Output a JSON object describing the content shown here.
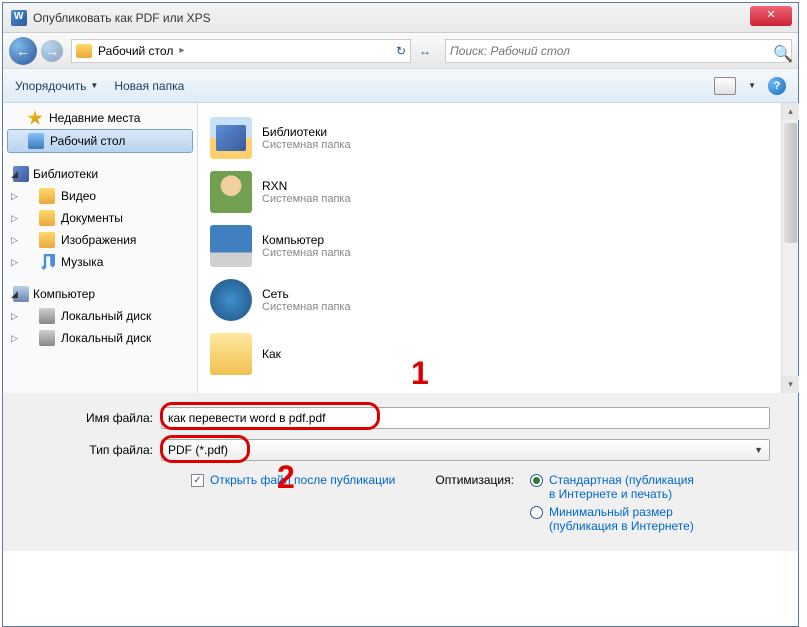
{
  "titlebar": {
    "title": "Опубликовать как PDF или XPS",
    "close": "✕"
  },
  "nav": {
    "location": "Рабочий стол",
    "arrow": "▸",
    "search_placeholder": "Поиск: Рабочий стол"
  },
  "toolbar": {
    "organize": "Упорядочить",
    "new_folder": "Новая папка",
    "help": "?"
  },
  "sidebar": {
    "recent": "Недавние места",
    "desktop": "Рабочий стол",
    "libraries": "Библиотеки",
    "video": "Видео",
    "documents": "Документы",
    "images": "Изображения",
    "music": "Музыка",
    "computer": "Компьютер",
    "disk1": "Локальный диск",
    "disk2": "Локальный диск"
  },
  "files": [
    {
      "name": "Библиотеки",
      "sub": "Системная папка"
    },
    {
      "name": "RXN",
      "sub": "Системная папка"
    },
    {
      "name": "Компьютер",
      "sub": "Системная папка"
    },
    {
      "name": "Сеть",
      "sub": "Системная папка"
    },
    {
      "name": "Как",
      "sub": ""
    }
  ],
  "form": {
    "filename_label": "Имя файла:",
    "filename_value": "как перевести word в pdf.pdf",
    "filetype_label": "Тип файла:",
    "filetype_value": "PDF (*.pdf)",
    "open_after_label": "Открыть файл после публикации",
    "optimize_label": "Оптимизация:",
    "opt_standard": "Стандартная (публикация в Интернете и печать)",
    "opt_minimal": "Минимальный размер (публикация в Интернете)"
  },
  "markers": {
    "m1": "1",
    "m2": "2"
  }
}
